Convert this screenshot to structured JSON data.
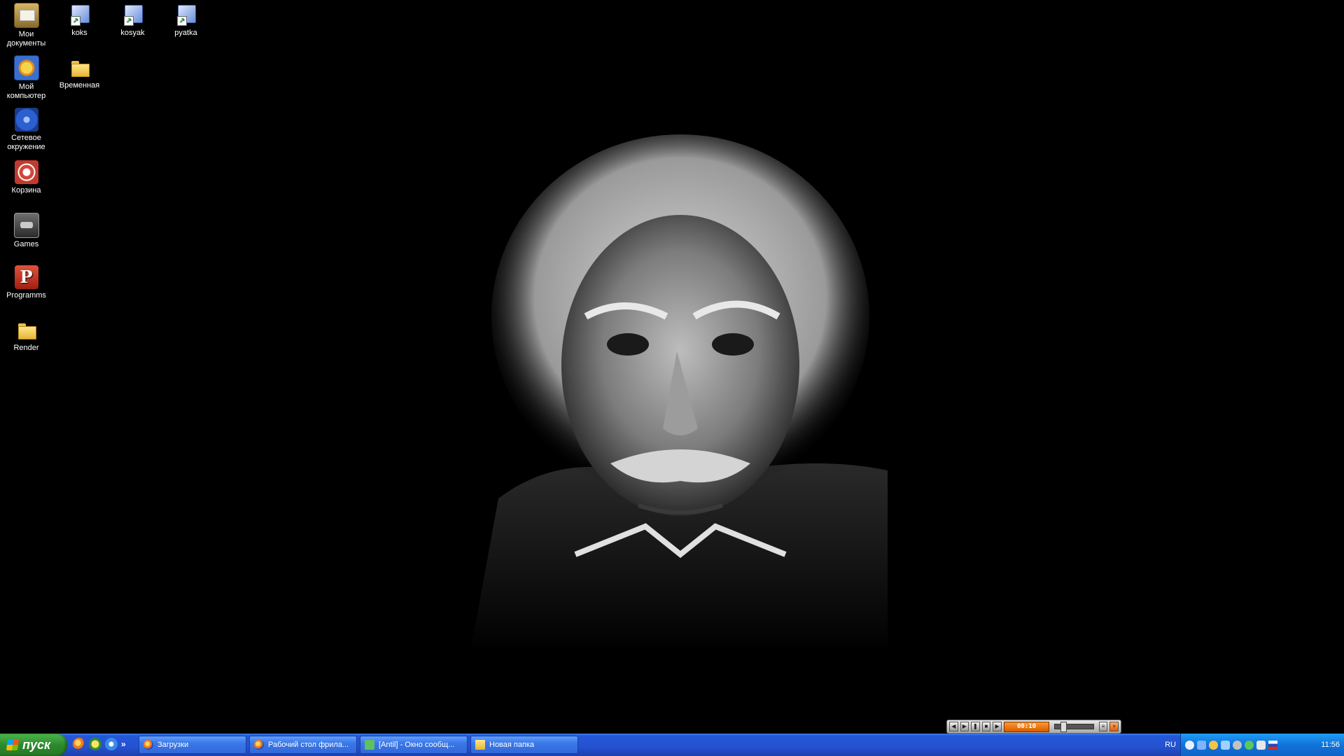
{
  "desktop": {
    "icons": [
      {
        "label": "Мои документы",
        "icon": "my-documents-icon"
      },
      {
        "label": "Мой компьютер",
        "icon": "my-computer-icon"
      },
      {
        "label": "Сетевое окружение",
        "icon": "network-icon"
      },
      {
        "label": "Корзина",
        "icon": "recycle-bin-icon"
      },
      {
        "label": "Games",
        "icon": "games-icon"
      },
      {
        "label": "Programms",
        "icon": "programs-icon"
      },
      {
        "label": "Render",
        "icon": "folder-icon"
      },
      {
        "label": "koks",
        "icon": "shortcut-icon"
      },
      {
        "label": "Временная",
        "icon": "folder-icon"
      },
      {
        "label": "kosyak",
        "icon": "shortcut-icon"
      },
      {
        "label": "pyatka",
        "icon": "shortcut-icon"
      }
    ],
    "programs_glyph": "P",
    "wallpaper": "black-and-white-portrait"
  },
  "media_player": {
    "display": "00:10",
    "buttons": [
      "prev-icon",
      "play-icon",
      "pause-icon",
      "stop-icon",
      "next-icon"
    ]
  },
  "taskbar": {
    "start_label": "пуск",
    "quick_launch": [
      "firefox-icon",
      "messenger-icon",
      "ie-icon"
    ],
    "more": "»",
    "tasks": [
      {
        "label": "Загрузки",
        "icon": "firefox-icon"
      },
      {
        "label": "Рабочий стол фрила...",
        "icon": "firefox-icon"
      },
      {
        "label": "[Antil] - Окно сообщ...",
        "icon": "messenger-icon"
      },
      {
        "label": "Новая папка",
        "icon": "folder-icon"
      }
    ],
    "language": "RU",
    "clock": "11:56"
  },
  "colors": {
    "taskbar": "#2552d0",
    "start": "#2d8a2d",
    "tray": "#1173d9"
  }
}
